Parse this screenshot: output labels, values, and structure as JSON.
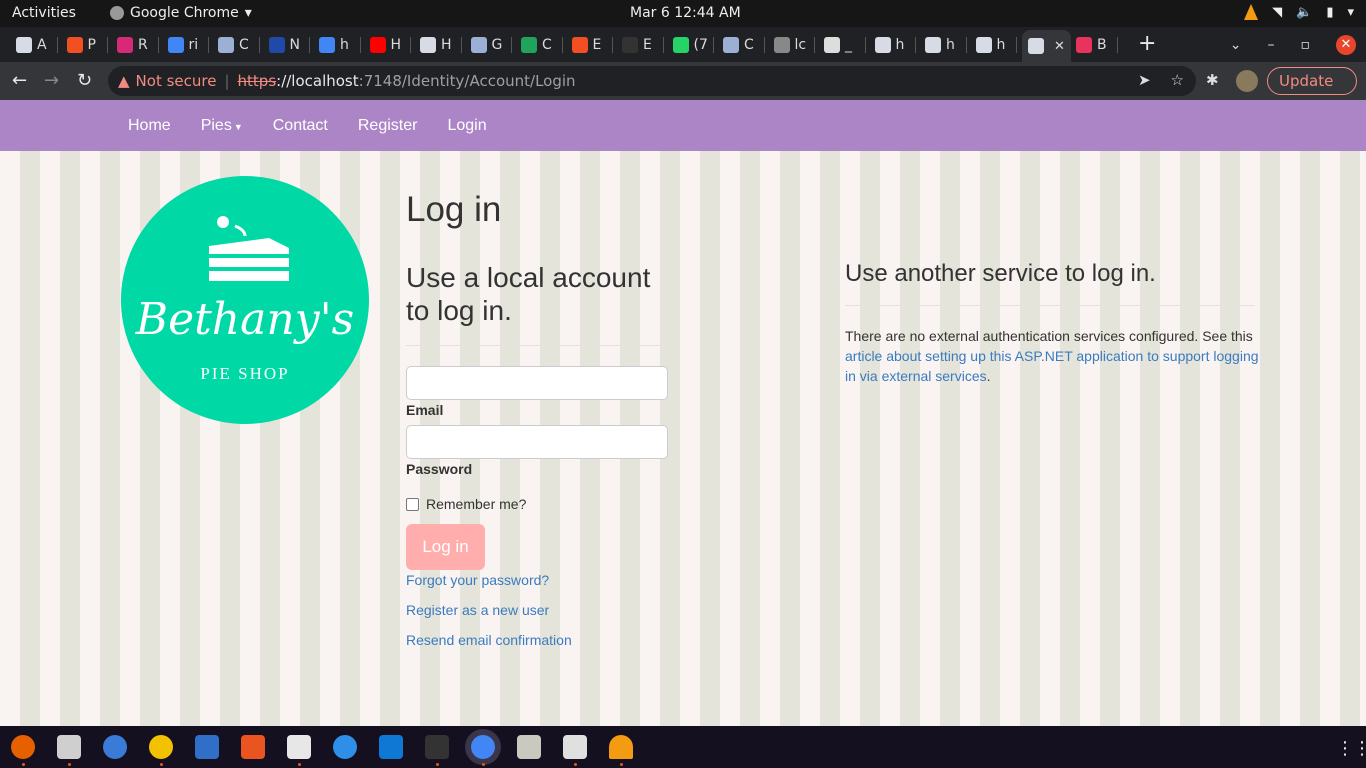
{
  "system": {
    "activities": "Activities",
    "app_name": "Google Chrome",
    "clock": "Mar 6  12:44 AM"
  },
  "tabs": [
    {
      "label": "A",
      "icon": "doc-icon",
      "color": "#d7dbe5"
    },
    {
      "label": "P",
      "icon": "microsoft-icon",
      "color": "#f25022"
    },
    {
      "label": "R",
      "icon": "instagram-icon",
      "color": "#d62976"
    },
    {
      "label": "ri",
      "icon": "google-icon",
      "color": "#4285f4"
    },
    {
      "label": "C",
      "icon": "brain-icon",
      "color": "#9cb0d6"
    },
    {
      "label": "N",
      "icon": "globe-icon",
      "color": "#1f4aa8"
    },
    {
      "label": "h",
      "icon": "google-icon",
      "color": "#4285f4"
    },
    {
      "label": "H",
      "icon": "youtube-icon",
      "color": "#ff0000"
    },
    {
      "label": "H",
      "icon": "doc-icon",
      "color": "#d7dbe5"
    },
    {
      "label": "G",
      "icon": "brain-icon",
      "color": "#9cb0d6"
    },
    {
      "label": "C",
      "icon": "w-icon",
      "color": "#20a35b"
    },
    {
      "label": "E",
      "icon": "microsoft-icon",
      "color": "#f25022"
    },
    {
      "label": "E",
      "icon": "github-icon",
      "color": "#333333"
    },
    {
      "label": "(7",
      "icon": "whatsapp-icon",
      "color": "#25d366"
    },
    {
      "label": "C",
      "icon": "brain-icon",
      "color": "#9cb0d6"
    },
    {
      "label": "lc",
      "icon": "globe-icon",
      "color": "#888888"
    },
    {
      "label": "_",
      "icon": "globe-icon",
      "color": "#dddddd"
    },
    {
      "label": "h",
      "icon": "doc-icon",
      "color": "#d7dbe5"
    },
    {
      "label": "h",
      "icon": "doc-icon",
      "color": "#d7dbe5"
    },
    {
      "label": "h",
      "icon": "doc-icon",
      "color": "#d7dbe5"
    },
    {
      "label": "",
      "icon": "doc-icon",
      "color": "#d7dbe5",
      "active": true
    },
    {
      "label": "B",
      "icon": "record-icon",
      "color": "#e8335d"
    }
  ],
  "toolbar": {
    "not_secure": "Not secure",
    "url_scheme": "https",
    "url_host": "://localhost",
    "url_path": ":7148/Identity/Account/Login",
    "update_label": "Update"
  },
  "navbar": {
    "items": [
      "Home",
      "Pies",
      "Contact",
      "Register",
      "Login"
    ]
  },
  "logo": {
    "brand": "Bethany's",
    "sub": "PIE SHOP"
  },
  "login": {
    "title": "Log in",
    "local_heading_line1": "Use a local account",
    "local_heading_line2": "to log in.",
    "email_label": "Email",
    "password_label": "Password",
    "remember_label": "Remember me?",
    "submit_label": "Log in",
    "forgot_link": "Forgot your password?",
    "register_link": "Register as a new user",
    "resend_link": "Resend email confirmation"
  },
  "external": {
    "heading": "Use another service to log in.",
    "text": "There are no external authentication services configured. See this",
    "link": "article about setting up this ASP.NET application to support logging in via external services",
    "end": "."
  },
  "colors": {
    "navbar": "#ac85c6",
    "logo": "#00d8a6",
    "button": "#ffadad",
    "link": "#3b7bbf"
  }
}
